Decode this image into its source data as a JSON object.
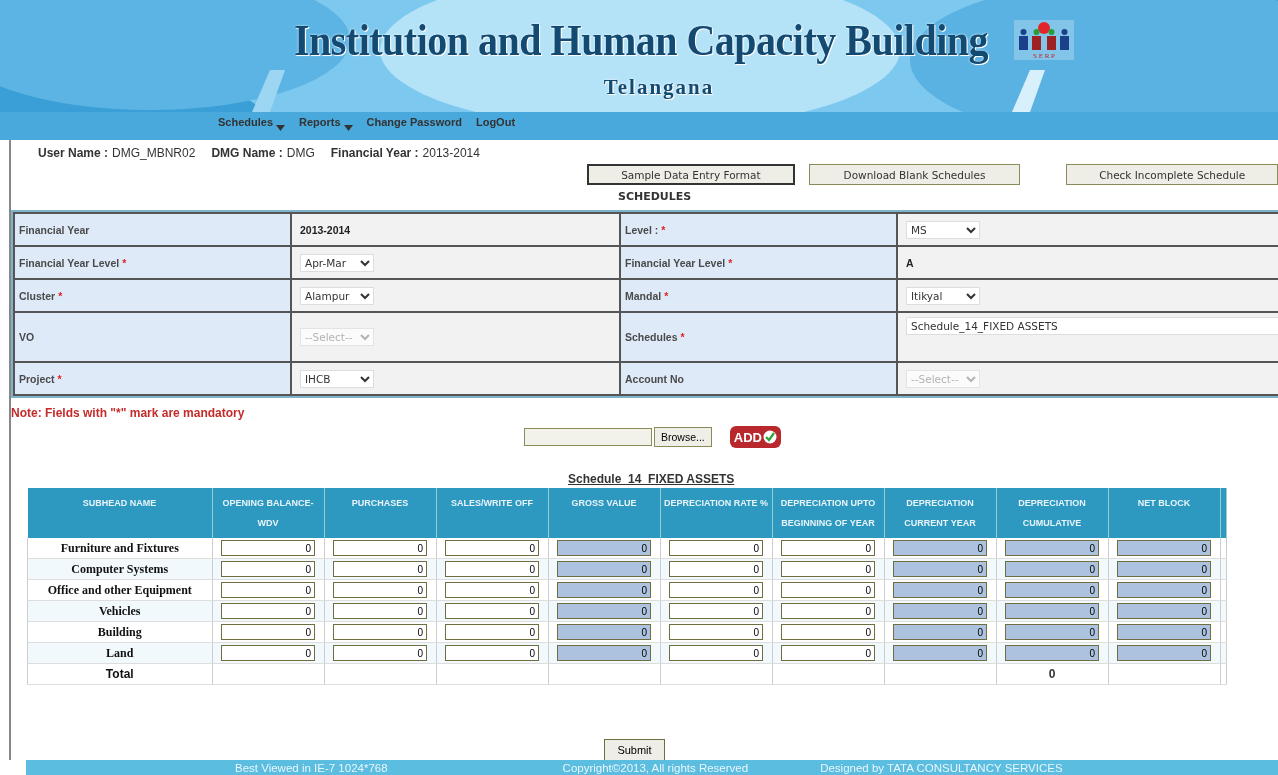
{
  "header": {
    "title": "Institution and Human Capacity Building",
    "subtitle": "Telangana",
    "logo_text": "S E R P"
  },
  "menu": [
    {
      "label": "Schedules",
      "dropdown": true
    },
    {
      "label": "Reports",
      "dropdown": true
    },
    {
      "label": "Change Password",
      "dropdown": false
    },
    {
      "label": "LogOut",
      "dropdown": false
    }
  ],
  "user_info": [
    {
      "label": "User Name :",
      "value": "DMG_MBNR02"
    },
    {
      "label": "DMG Name :",
      "value": "DMG"
    },
    {
      "label": "Financial Year :",
      "value": "2013-2014"
    }
  ],
  "top_buttons": [
    "Sample Data Entry Format",
    "Download Blank Schedules",
    "Check Incomplete Schedule"
  ],
  "section_title": "SCHEDULES",
  "required_mark": "*",
  "form_rows": [
    {
      "left": {
        "label": "Financial Year",
        "required": false,
        "kind": "text",
        "value": "2013-2014"
      },
      "right": {
        "label": "Level :",
        "required": true,
        "kind": "select",
        "value": "MS",
        "disabled": false
      }
    },
    {
      "left": {
        "label": "Financial Year Level",
        "required": true,
        "kind": "select",
        "value": "Apr-Mar",
        "disabled": false
      },
      "right": {
        "label": "Financial Year Level",
        "required": true,
        "kind": "text",
        "value": "A"
      }
    },
    {
      "left": {
        "label": "Cluster",
        "required": true,
        "kind": "select",
        "value": "Alampur",
        "disabled": false
      },
      "right": {
        "label": "Mandal",
        "required": true,
        "kind": "select",
        "value": "Itikyal",
        "disabled": false
      }
    },
    {
      "left": {
        "label": "VO",
        "required": false,
        "kind": "select",
        "value": "--Select--",
        "disabled": true
      },
      "right": {
        "label": "Schedules",
        "required": true,
        "kind": "select_wide",
        "value": "Schedule_14_FIXED ASSETS",
        "disabled": false
      }
    },
    {
      "left": {
        "label": "Project",
        "required": true,
        "kind": "select",
        "value": "IHCB",
        "disabled": false
      },
      "right": {
        "label": "Account No",
        "required": false,
        "kind": "select",
        "value": "--Select--",
        "disabled": true
      }
    }
  ],
  "note": "Note: Fields with \"*\" mark are mandatory",
  "upload": {
    "browse": "Browse...",
    "add": "ADD"
  },
  "schedule": {
    "title": "Schedule_14_FIXED ASSETS",
    "columns": [
      {
        "label": "SUBHEAD NAME",
        "kind": "name"
      },
      {
        "label": "OPENING BALANCE-WDV",
        "kind": "input"
      },
      {
        "label": "PURCHASES",
        "kind": "input"
      },
      {
        "label": "SALES/WRITE OFF",
        "kind": "input"
      },
      {
        "label": "GROSS VALUE",
        "kind": "computed"
      },
      {
        "label": "DEPRECIATION RATE %",
        "kind": "input"
      },
      {
        "label": "DEPRECIATION UPTO BEGINNING OF YEAR",
        "kind": "input"
      },
      {
        "label": "DEPRECIATION CURRENT YEAR",
        "kind": "computed"
      },
      {
        "label": "DEPRECIATION CUMULATIVE",
        "kind": "computed",
        "total": "0"
      },
      {
        "label": "NET BLOCK",
        "kind": "computed"
      }
    ],
    "rows": [
      {
        "name": "Furniture and Fixtures",
        "values": [
          "0",
          "0",
          "0",
          "0",
          "0",
          "0",
          "0",
          "0",
          "0"
        ]
      },
      {
        "name": "Computer Systems",
        "values": [
          "0",
          "0",
          "0",
          "0",
          "0",
          "0",
          "0",
          "0",
          "0"
        ]
      },
      {
        "name": "Office and other Equipment",
        "values": [
          "0",
          "0",
          "0",
          "0",
          "0",
          "0",
          "0",
          "0",
          "0"
        ]
      },
      {
        "name": "Vehicles",
        "values": [
          "0",
          "0",
          "0",
          "0",
          "0",
          "0",
          "0",
          "0",
          "0"
        ]
      },
      {
        "name": "Building",
        "values": [
          "0",
          "0",
          "0",
          "0",
          "0",
          "0",
          "0",
          "0",
          "0"
        ]
      },
      {
        "name": "Land",
        "values": [
          "0",
          "0",
          "0",
          "0",
          "0",
          "0",
          "0",
          "0",
          "0"
        ]
      }
    ],
    "total_label": "Total"
  },
  "submit": "Submit",
  "footer": [
    "Best Viewed in IE-7 1024*768",
    "Copyright©2013, All rights Reserved",
    "Designed by TATA CONSULTANCY SERVICES"
  ]
}
